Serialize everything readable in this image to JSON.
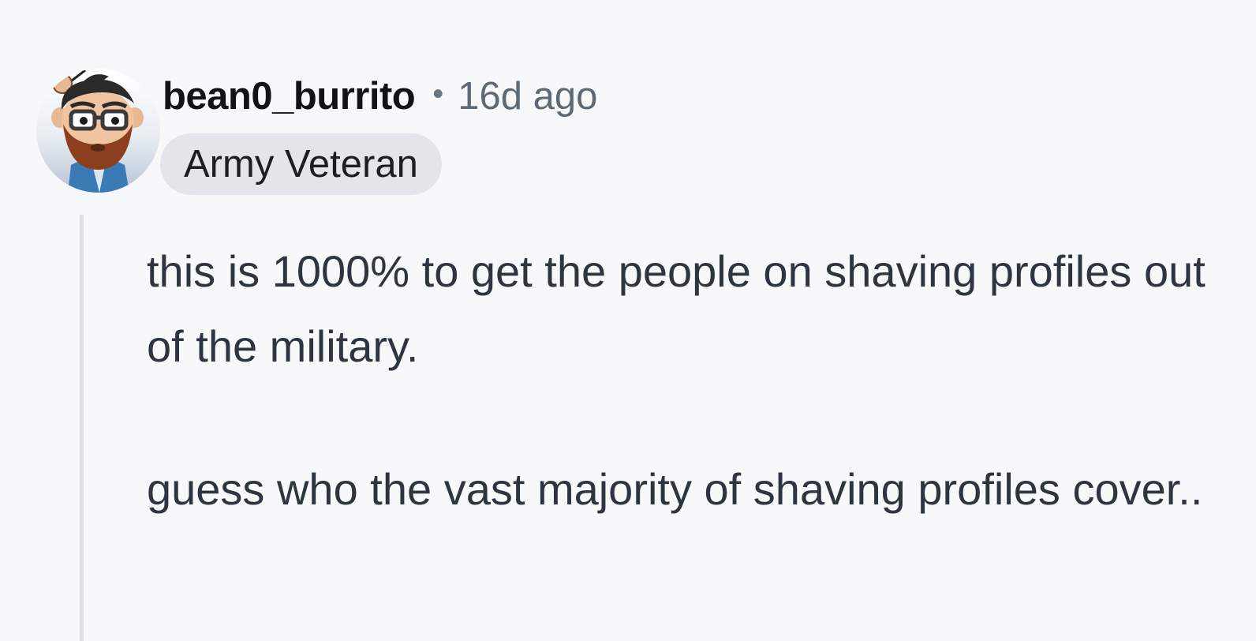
{
  "comment": {
    "username": "bean0_burrito",
    "separator": "•",
    "timestamp": "16d ago",
    "flair": "Army Veteran",
    "paragraphs": [
      "this is 1000% to get the people on shaving profiles out of the military.",
      "guess who the vast majority of shaving profiles cover.."
    ]
  },
  "avatar": {
    "icon": "bearded-snoo-avatar"
  },
  "colors": {
    "background": "#f7f8fa",
    "username": "#111417",
    "meta": "#5d6a75",
    "flair_bg": "#e2e6ea",
    "body_text": "#2c3540",
    "thread_line": "#dde1e5"
  }
}
